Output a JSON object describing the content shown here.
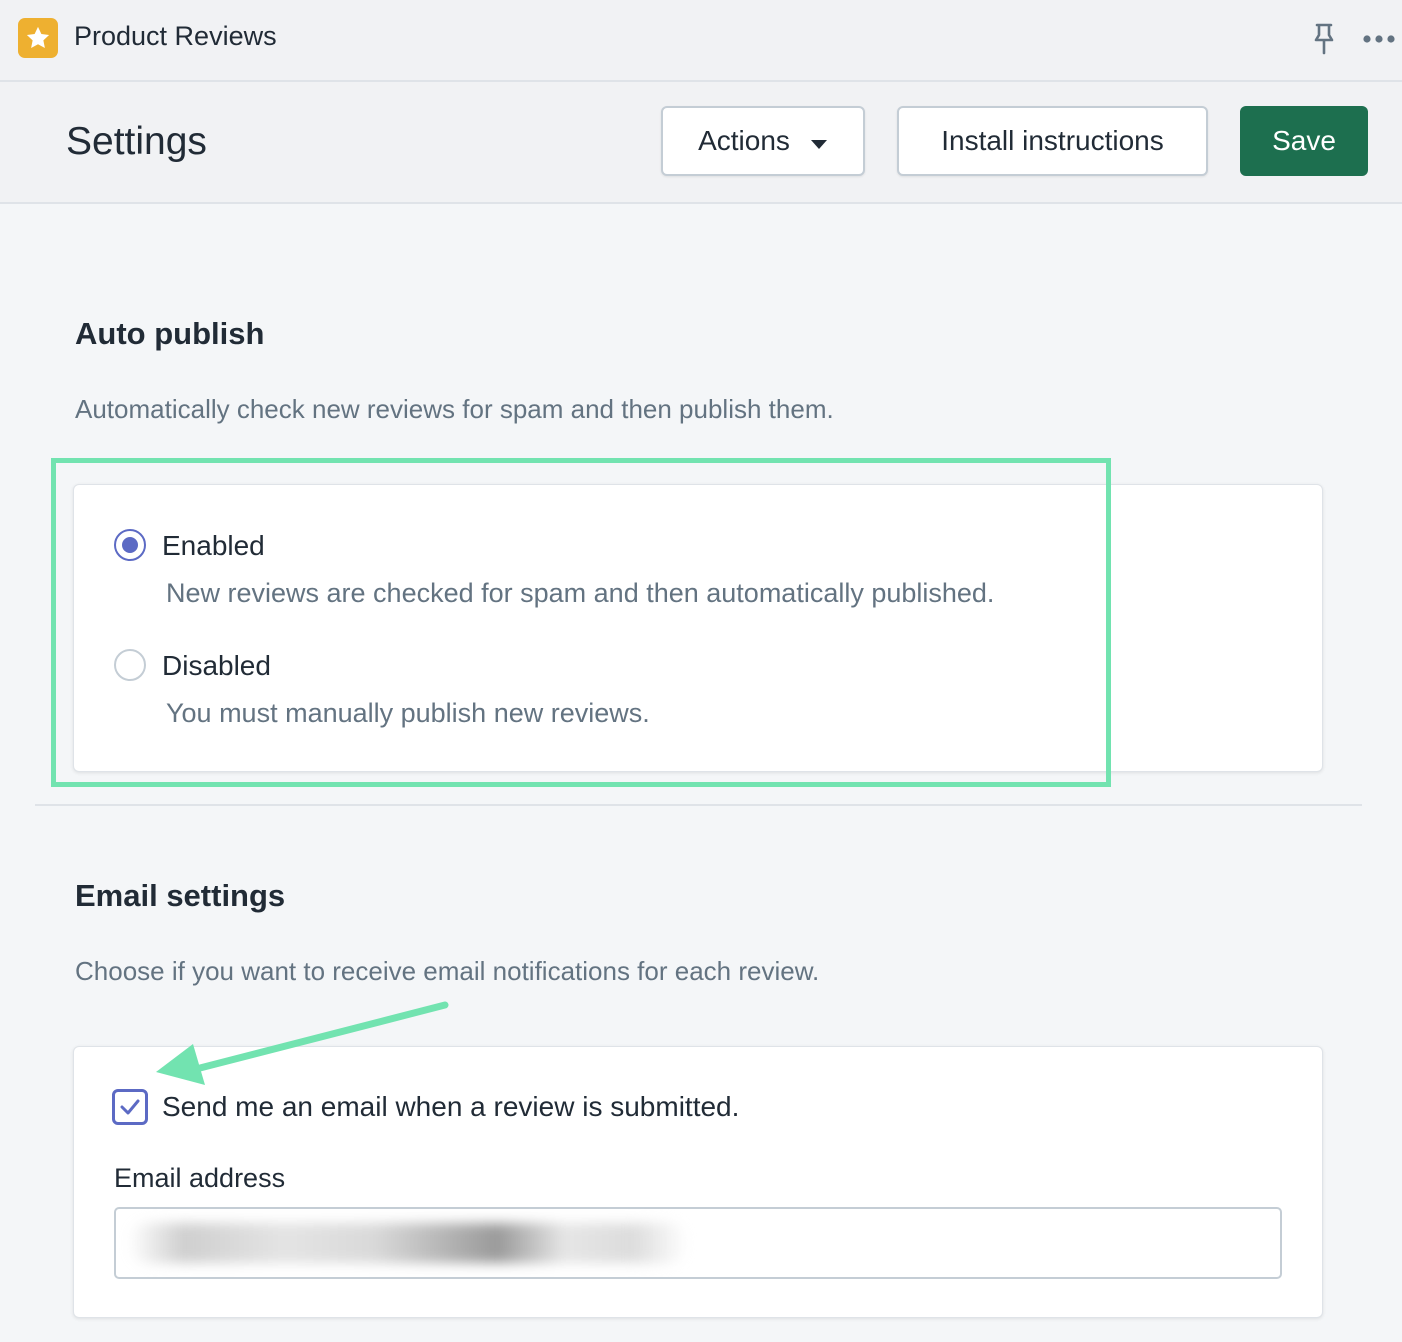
{
  "app": {
    "title": "Product Reviews",
    "icon": "star-icon",
    "icon_color": "#eeb030"
  },
  "topbar": {
    "pin_icon": "pin-icon",
    "more_icon": "more-horizontal-icon"
  },
  "header": {
    "title": "Settings",
    "actions_label": "Actions",
    "install_label": "Install instructions",
    "save_label": "Save",
    "save_color": "#1d6f4f"
  },
  "auto_publish": {
    "title": "Auto publish",
    "description": "Automatically check new reviews for spam and then publish them.",
    "selected": "enabled",
    "options": [
      {
        "value": "enabled",
        "label": "Enabled",
        "help": "New reviews are checked for spam and then automatically published."
      },
      {
        "value": "disabled",
        "label": "Disabled",
        "help": "You must manually publish new reviews."
      }
    ]
  },
  "email_settings": {
    "title": "Email settings",
    "description": "Choose if you want to receive email notifications for each review.",
    "notify_checked": true,
    "notify_label": "Send me an email when a review is submitted.",
    "email_label": "Email address",
    "email_value": ""
  },
  "annotation": {
    "highlight_color": "#72e3b0"
  }
}
